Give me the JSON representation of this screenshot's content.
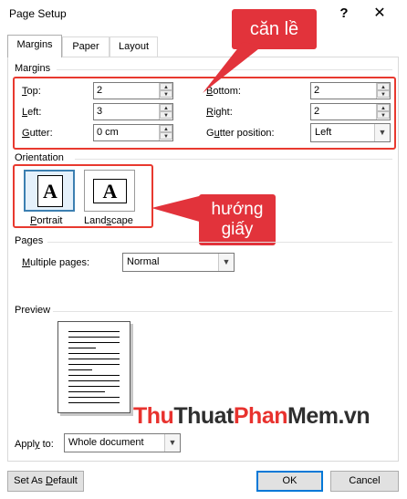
{
  "window": {
    "title": "Page Setup",
    "help": "?",
    "close": "✕"
  },
  "tabs": [
    {
      "label": "Margins"
    },
    {
      "label": "Paper"
    },
    {
      "label": "Layout"
    }
  ],
  "margins": {
    "group_label": "Margins",
    "top": {
      "pre": "",
      "u": "T",
      "post": "op:",
      "value": "2"
    },
    "bottom": {
      "pre": "",
      "u": "B",
      "post": "ottom:",
      "value": "2"
    },
    "left": {
      "pre": "",
      "u": "L",
      "post": "eft:",
      "value": "3"
    },
    "right": {
      "pre": "",
      "u": "R",
      "post": "ight:",
      "value": "2"
    },
    "gutter": {
      "pre": "",
      "u": "G",
      "post": "utter:",
      "value": "0 cm"
    },
    "gutter_position": {
      "pre": "G",
      "u": "u",
      "post": "tter position:",
      "value": "Left"
    }
  },
  "orientation": {
    "group_label": "Orientation",
    "portrait": {
      "pre": "",
      "u": "P",
      "post": "ortrait",
      "glyph": "A"
    },
    "landscape": {
      "pre": "Land",
      "u": "s",
      "post": "cape",
      "glyph": "A"
    }
  },
  "pages": {
    "group_label": "Pages",
    "multiple_pages": {
      "pre": "",
      "u": "M",
      "post": "ultiple pages:",
      "value": "Normal"
    }
  },
  "preview": {
    "group_label": "Preview"
  },
  "apply": {
    "pre": "Appl",
    "u": "y",
    "post": " to:",
    "value": "Whole document"
  },
  "buttons": {
    "set_default": {
      "pre": "Set As ",
      "u": "D",
      "post": "efault"
    },
    "ok": "OK",
    "cancel": "Cancel"
  },
  "annotations": {
    "margins_callout": "căn lề",
    "orientation_callout_line1": "hướng",
    "orientation_callout_line2": "giấy",
    "callout_color": "#e2333b"
  },
  "watermark": {
    "part1": "Thu",
    "part2": "Thuat",
    "part3": "Phan",
    "part4": "Mem",
    "part5": ".vn"
  },
  "icons": {
    "spin_up": "▲",
    "spin_down": "▼",
    "dropdown": "▼"
  }
}
